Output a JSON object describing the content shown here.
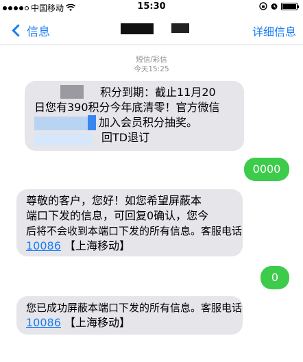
{
  "status_bar": {
    "carrier": "中国移动",
    "time": "15:30"
  },
  "nav": {
    "back_label": "信息",
    "details_label": "详细信息"
  },
  "thread": {
    "type_label": "短信/彩信",
    "timestamp": "今天15:25"
  },
  "messages": [
    {
      "direction": "incoming",
      "lines": [
        "积分到期：截止11月20",
        "日您有390积分今年底清零！官方微信",
        "加入会员积分抽奖。",
        "回TD退订"
      ]
    },
    {
      "direction": "outgoing",
      "text": "0000"
    },
    {
      "direction": "incoming",
      "lines": [
        "尊敬的客户，您好！如您希望屏蔽本",
        "端口下发的信息，可回复0确认，您今",
        "后将不会收到本端口下发的所有信息。客服电话"
      ],
      "phone": "10086",
      "suffix": "【上海移动】"
    },
    {
      "direction": "outgoing",
      "text": "0"
    },
    {
      "direction": "incoming",
      "lines": [
        "您已成功屏蔽本端口下发的所有信息。客服电话"
      ],
      "phone": "10086",
      "suffix": "【上海移动】"
    }
  ],
  "colors": {
    "accent": "#1a7cf5",
    "incoming_bubble": "#e5e5ea",
    "outgoing_bubble": "#3dcb4b"
  }
}
